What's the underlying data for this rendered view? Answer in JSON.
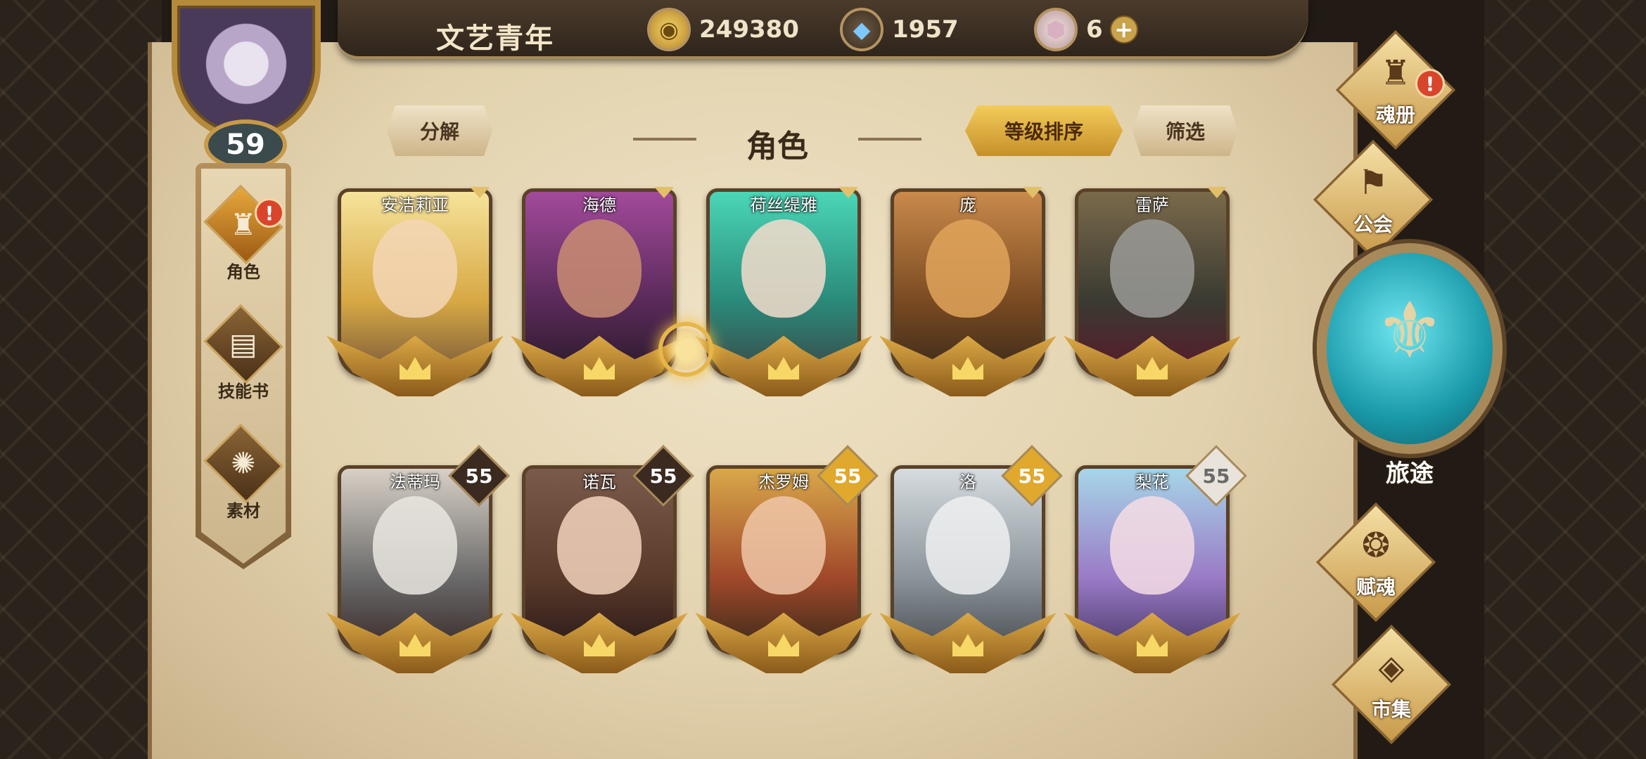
{
  "player": {
    "name": "文艺青年",
    "level": "59"
  },
  "resources": {
    "gold": "249380",
    "crystal": "1957",
    "gem": "6",
    "gem_add": "+"
  },
  "left_nav": [
    {
      "label": "角色",
      "icon": "helmet-icon",
      "alert": "!"
    },
    {
      "label": "技能书",
      "icon": "skill-book-icon"
    },
    {
      "label": "素材",
      "icon": "material-icon"
    }
  ],
  "header": {
    "decompose": "分解",
    "title": "角色",
    "sort": "等级排序",
    "filter": "筛选"
  },
  "cards_row1": [
    {
      "name": "安洁莉亚"
    },
    {
      "name": "海德"
    },
    {
      "name": "荷丝缇雅"
    },
    {
      "name": "庞"
    },
    {
      "name": "雷萨"
    }
  ],
  "cards_row2": [
    {
      "name": "法蒂玛",
      "level": "55",
      "badge": "dark"
    },
    {
      "name": "诺瓦",
      "level": "55",
      "badge": "dark"
    },
    {
      "name": "杰罗姆",
      "level": "55",
      "badge": "gold"
    },
    {
      "name": "洛",
      "level": "55",
      "badge": "gold"
    },
    {
      "name": "梨花",
      "level": "55",
      "badge": "silver"
    }
  ],
  "right_menu": {
    "soul_book": "魂册",
    "soul_book_alert": "!",
    "guild": "公会",
    "journey": "旅途",
    "soul_gift": "赋魂",
    "market": "市集"
  },
  "colors": {
    "accent_gold": "#e0a82c",
    "parchment": "#e2d2ad",
    "journey_teal": "#1a9aaa"
  }
}
